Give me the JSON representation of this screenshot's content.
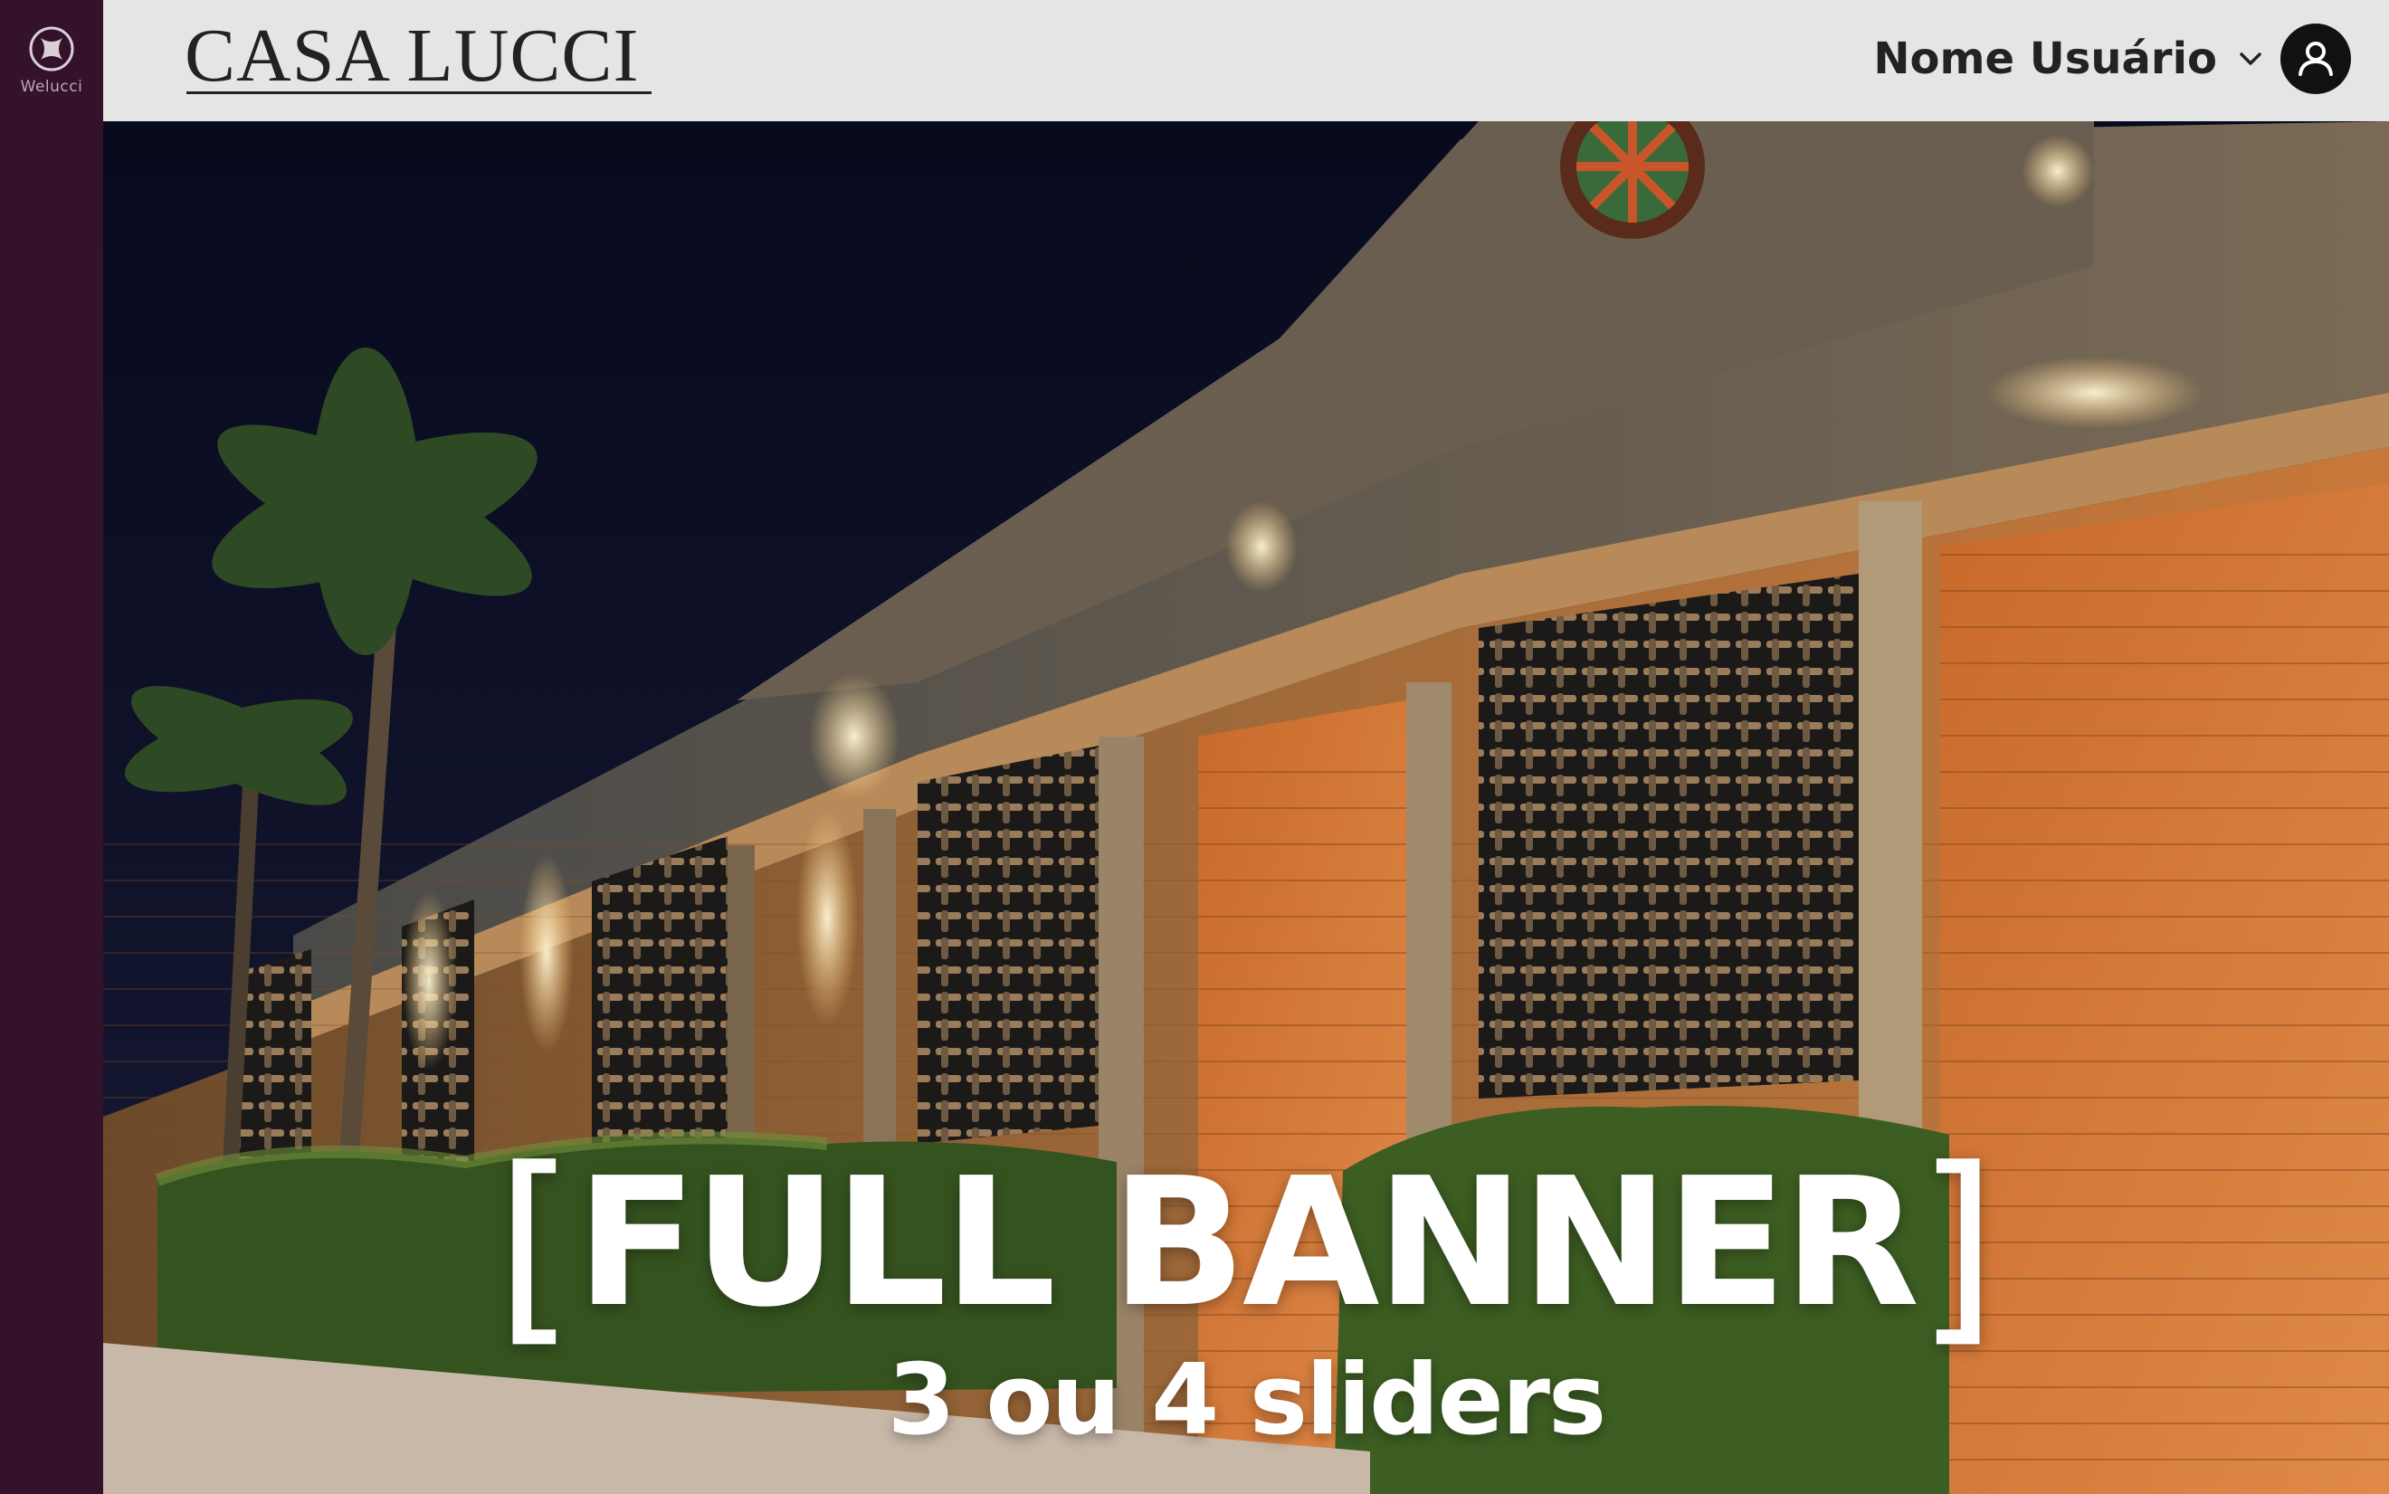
{
  "sidebar": {
    "logo_icon": "welucci-logo-icon",
    "logo_label": "Welucci"
  },
  "header": {
    "brand": "CASA LUCCI",
    "user_name": "Nome Usuário",
    "dropdown_icon": "chevron-down-icon",
    "avatar_icon": "user-avatar-icon"
  },
  "banner": {
    "title_open": "[",
    "title": "FULL BANNER",
    "title_close": "]",
    "subtitle": "3 ou 4 sliders"
  },
  "colors": {
    "sidebar": "#35122c",
    "header": "#e5e5e5",
    "text_dark": "#222222",
    "banner_text": "#ffffff"
  }
}
